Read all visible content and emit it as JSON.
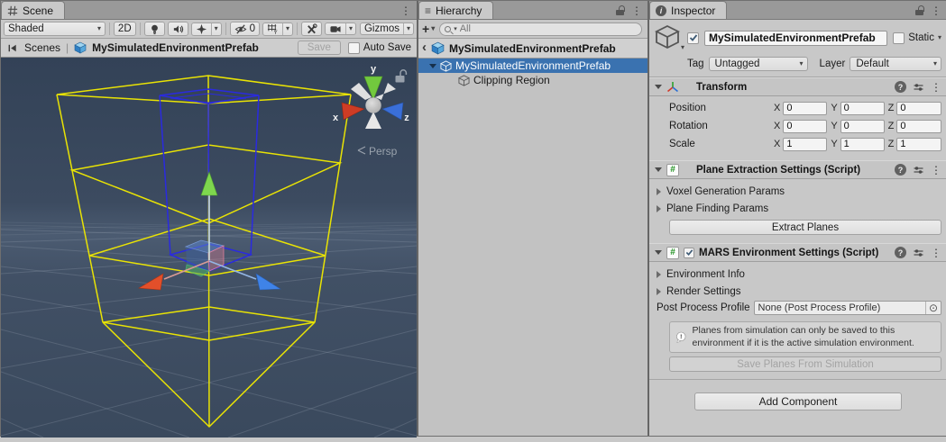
{
  "scene": {
    "tab": "Scene",
    "toolbar": {
      "shading_mode": "Shaded",
      "toggle_2d": "2D",
      "hidden_count": "0",
      "grid_axis": "Y",
      "gizmos": "Gizmos"
    },
    "breadcrumb": {
      "scenes": "Scenes",
      "prefab_name": "MySimulatedEnvironmentPrefab",
      "save": "Save",
      "auto_save": "Auto Save"
    },
    "viewport": {
      "projection": "Persp",
      "axis_x": "x",
      "axis_y": "y",
      "axis_z": "z"
    }
  },
  "hierarchy": {
    "tab": "Hierarchy",
    "add_button": "+",
    "search_placeholder": "All",
    "prefab_header": "MySimulatedEnvironmentPrefab",
    "rows": [
      {
        "label": "MySimulatedEnvironmentPrefab"
      },
      {
        "label": "Clipping Region"
      }
    ]
  },
  "inspector": {
    "tab": "Inspector",
    "header": {
      "name": "MySimulatedEnvironmentPrefab",
      "static_label": "Static",
      "tag_label": "Tag",
      "tag_value": "Untagged",
      "layer_label": "Layer",
      "layer_value": "Default"
    },
    "transform": {
      "title": "Transform",
      "axis_labels": {
        "x": "X",
        "y": "Y",
        "z": "Z"
      },
      "rows": [
        {
          "label": "Position",
          "x": "0",
          "y": "0",
          "z": "0"
        },
        {
          "label": "Rotation",
          "x": "0",
          "y": "0",
          "z": "0"
        },
        {
          "label": "Scale",
          "x": "1",
          "y": "1",
          "z": "1"
        }
      ]
    },
    "plane_extraction": {
      "title": "Plane Extraction Settings (Script)",
      "foldouts": [
        "Voxel Generation Params",
        "Plane Finding Params"
      ],
      "button": "Extract Planes"
    },
    "mars_settings": {
      "title": "MARS Environment Settings (Script)",
      "foldouts": [
        "Environment Info",
        "Render Settings"
      ],
      "post_process_label": "Post Process Profile",
      "post_process_value": "None (Post Process Profile)",
      "help_text": "Planes from simulation can only be saved to this environment if it is the active simulation environment.",
      "save_button": "Save Planes From Simulation"
    },
    "add_component": "Add Component"
  },
  "colors": {
    "selection_blue": "#3a72b0",
    "wire_yellow": "#e9e304",
    "wire_blue": "#2a2ae0",
    "gizmo_red": "#e34f2a",
    "gizmo_green": "#7ed74e",
    "gizmo_blue": "#3f83e8",
    "scene_bg": "#3b4a5e"
  }
}
